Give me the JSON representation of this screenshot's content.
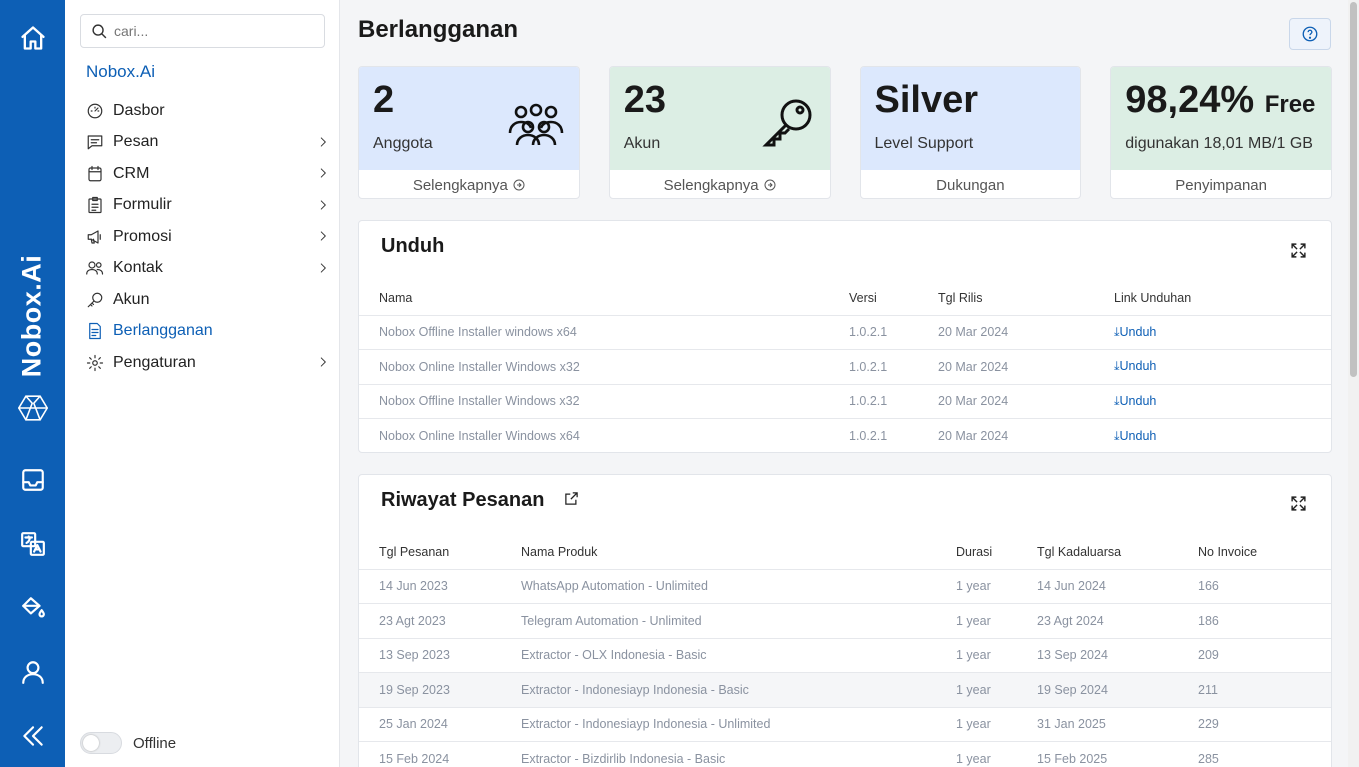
{
  "rail": {
    "brand": "Nobox.Ai",
    "icons": [
      "home-icon",
      "hexagon-logo-icon",
      "inbox-icon",
      "translate-icon",
      "paint-bucket-icon",
      "user-icon",
      "collapse-icon"
    ]
  },
  "sidebar": {
    "search_placeholder": "cari...",
    "org_name": "Nobox.Ai",
    "items": [
      {
        "label": "Dasbor",
        "icon": "gauge-icon",
        "chevron": false,
        "active": false
      },
      {
        "label": "Pesan",
        "icon": "message-icon",
        "chevron": true,
        "active": false
      },
      {
        "label": "CRM",
        "icon": "crm-icon",
        "chevron": true,
        "active": false
      },
      {
        "label": "Formulir",
        "icon": "clipboard-icon",
        "chevron": true,
        "active": false
      },
      {
        "label": "Promosi",
        "icon": "megaphone-icon",
        "chevron": true,
        "active": false
      },
      {
        "label": "Kontak",
        "icon": "contacts-icon",
        "chevron": true,
        "active": false
      },
      {
        "label": "Akun",
        "icon": "key-icon",
        "chevron": false,
        "active": false
      },
      {
        "label": "Berlangganan",
        "icon": "document-icon",
        "chevron": false,
        "active": true
      },
      {
        "label": "Pengaturan",
        "icon": "gear-icon",
        "chevron": true,
        "active": false
      }
    ],
    "toggle_label": "Offline",
    "toggle_on": false
  },
  "main": {
    "title": "Berlangganan",
    "cards": [
      {
        "value": "2",
        "label": "Anggota",
        "footer": "Selengkapnya",
        "footer_arrow": true,
        "icon": "group-icon",
        "color": "#dce8fd"
      },
      {
        "value": "23",
        "label": "Akun",
        "footer": "Selengkapnya",
        "footer_arrow": true,
        "icon": "key-icon",
        "color": "#dceee4"
      },
      {
        "value": "Silver",
        "label": "Level Support",
        "footer": "Dukungan",
        "footer_arrow": false,
        "icon": "",
        "color": "#dce8fd"
      },
      {
        "value": "98,24%",
        "value_suffix": "Free",
        "label": "digunakan 18,01 MB/1 GB",
        "footer": "Penyimpanan",
        "footer_arrow": false,
        "icon": "",
        "color": "#dceee4"
      }
    ],
    "downloads": {
      "title": "Unduh",
      "headers": [
        "Nama",
        "Versi",
        "Tgl Rilis",
        "Link Unduhan"
      ],
      "rows": [
        [
          "Nobox Offline Installer windows x64",
          "1.0.2.1",
          "20 Mar 2024",
          "⤓Unduh"
        ],
        [
          "Nobox Online Installer Windows x32",
          "1.0.2.1",
          "20 Mar 2024",
          "⤓Unduh"
        ],
        [
          "Nobox Offline Installer Windows x32",
          "1.0.2.1",
          "20 Mar 2024",
          "⤓Unduh"
        ],
        [
          "Nobox Online Installer Windows x64",
          "1.0.2.1",
          "20 Mar 2024",
          "⤓Unduh"
        ]
      ]
    },
    "orders": {
      "title": "Riwayat Pesanan",
      "headers": [
        "Tgl Pesanan",
        "Nama Produk",
        "Durasi",
        "Tgl Kadaluarsa",
        "No Invoice"
      ],
      "rows": [
        [
          "14 Jun 2023",
          "WhatsApp Automation - Unlimited",
          "1 year",
          "14 Jun 2024",
          "166"
        ],
        [
          "23 Agt 2023",
          "Telegram Automation - Unlimited",
          "1 year",
          "23 Agt 2024",
          "186"
        ],
        [
          "13 Sep 2023",
          "Extractor - OLX Indonesia - Basic",
          "1 year",
          "13 Sep 2024",
          "209"
        ],
        [
          "19 Sep 2023",
          "Extractor - Indonesiayp Indonesia - Basic",
          "1 year",
          "19 Sep 2024",
          "211"
        ],
        [
          "25 Jan 2024",
          "Extractor - Indonesiayp Indonesia - Unlimited",
          "1 year",
          "31 Jan 2025",
          "229"
        ],
        [
          "15 Feb 2024",
          "Extractor - Bizdirlib Indonesia - Basic",
          "1 year",
          "15 Feb 2025",
          "285"
        ]
      ],
      "highlighted_row": 3
    }
  },
  "colors": {
    "brand": "#0d5fb5",
    "card_blue": "#dce8fd",
    "card_green": "#dceee4"
  }
}
